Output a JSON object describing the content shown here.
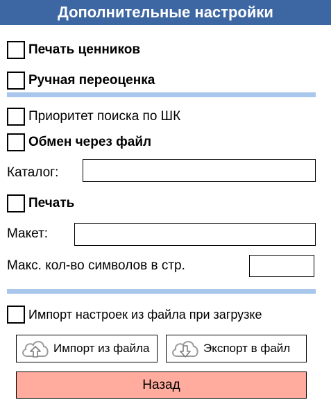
{
  "header": {
    "title": "Дополнительные настройки"
  },
  "options": {
    "print_tags": {
      "label": "Печать ценников",
      "checked": false
    },
    "manual_reprice": {
      "label": "Ручная переоценка",
      "checked": false
    },
    "barcode_priority": {
      "label": "Приоритет поиска по ШК",
      "checked": false
    },
    "file_exchange": {
      "label": "Обмен через файл",
      "checked": false
    },
    "print": {
      "label": "Печать",
      "checked": false
    },
    "import_on_load": {
      "label": "Импорт настроек из файла при загрузке",
      "checked": false
    }
  },
  "fields": {
    "catalog": {
      "label": "Каталог:",
      "value": ""
    },
    "layout": {
      "label": "Макет:",
      "value": ""
    },
    "max_chars": {
      "label": "Макс. кол-во символов в стр.",
      "value": ""
    }
  },
  "buttons": {
    "import_label": "Импорт из файла",
    "export_label": "Экспорт в файл",
    "back_label": "Назад"
  },
  "colors": {
    "header_bg": "#3d67a3",
    "separator": "#a9c7ec",
    "back_button": "#ffab9e"
  },
  "icons": {
    "import": "cloud-upload-icon",
    "export": "cloud-download-icon"
  }
}
